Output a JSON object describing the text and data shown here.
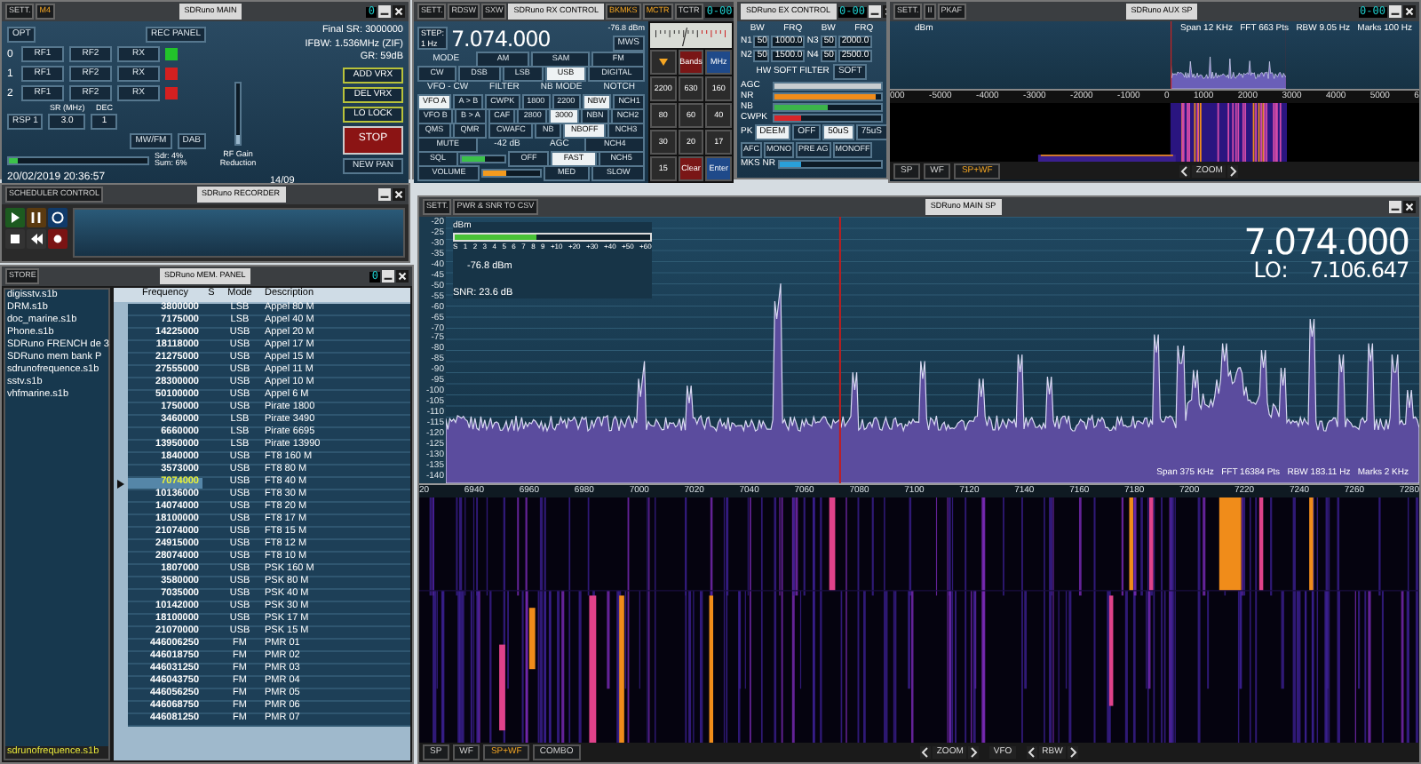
{
  "main_panel": {
    "title_buttons": [
      {
        "label": "SETT.",
        "selected": false
      },
      {
        "label": "M4",
        "selected": true
      }
    ],
    "title": "SDRuno MAIN",
    "display": "0",
    "opt": "OPT",
    "rec_panel": "REC PANEL",
    "info": [
      "Final SR: 3000000",
      "IFBW: 1.536MHz (ZIF)",
      "GR: 59dB"
    ],
    "rf_rows": [
      {
        "index": "0",
        "buttons": [
          "RF1",
          "RF2",
          "RX"
        ],
        "color": "#22c32a"
      },
      {
        "index": "1",
        "buttons": [
          "RF1",
          "RF2",
          "RX"
        ],
        "color": "#d42020"
      },
      {
        "index": "2",
        "buttons": [
          "RF1",
          "RF2",
          "RX"
        ],
        "color": "#d42020"
      }
    ],
    "side_buttons": [
      "ADD VRX",
      "DEL VRX",
      "LO LOCK"
    ],
    "device": "RSP 1",
    "sr_label": "SR (MHz)",
    "sr_value": "3.0",
    "dec_label": "DEC",
    "dec_value": "1",
    "mode_buttons": [
      "MW/FM",
      "DAB"
    ],
    "rf_gain": {
      "label": "RF Gain Reduction",
      "level": 0.15
    },
    "stop": "STOP",
    "new_pan": "NEW PAN",
    "cpu": {
      "level": 0.06
    },
    "stats": [
      "Sdr: 4%",
      "Sum: 6%"
    ],
    "datetime": "20/02/2019 20:36:57",
    "counter": "14/09"
  },
  "rx_control": {
    "title_buttons": [
      {
        "label": "SETT.",
        "selected": false
      },
      {
        "label": "RDSW",
        "selected": false
      },
      {
        "label": "SXW",
        "selected": false
      }
    ],
    "title": "SDRuno RX CONTROL",
    "title_buttons_right": [
      {
        "label": "BKMKS",
        "selected": true
      },
      {
        "label": "MCTR",
        "selected": true
      },
      {
        "label": "TCTR",
        "selected": false
      }
    ],
    "display": "0-00",
    "step_label": "STEP:",
    "step": "1 Hz",
    "frequency": "7.074.000",
    "level_reading": "-76.8 dBm",
    "mws": "MWS",
    "control_groups": [
      {
        "items": [
          {
            "kind": "label",
            "label": "MODE"
          },
          {
            "kind": "button",
            "label": "AM",
            "selected": false
          },
          {
            "kind": "button",
            "label": "SAM",
            "selected": false
          },
          {
            "kind": "button",
            "label": "FM",
            "selected": false
          }
        ]
      },
      {
        "items": [
          {
            "kind": "button",
            "label": "CW",
            "selected": false
          },
          {
            "kind": "button",
            "label": "DSB",
            "selected": false
          },
          {
            "kind": "button",
            "label": "LSB",
            "selected": false
          },
          {
            "kind": "button",
            "label": "USB",
            "selected": true
          },
          {
            "kind": "button",
            "label": "DIGITAL",
            "selected": false
          }
        ]
      },
      {
        "items": [
          {
            "kind": "label",
            "label": "VFO - CW"
          },
          {
            "kind": "label",
            "label": "FILTER"
          },
          {
            "kind": "label",
            "label": "NB MODE"
          },
          {
            "kind": "label",
            "label": "NOTCH"
          }
        ]
      },
      {
        "items": [
          {
            "kind": "button",
            "label": "VFO A",
            "selected": true
          },
          {
            "kind": "button",
            "label": "A > B",
            "selected": false
          },
          {
            "kind": "button",
            "label": "CWPK",
            "selected": false
          },
          {
            "kind": "button",
            "label": "1800",
            "selected": false
          },
          {
            "kind": "button",
            "label": "2200",
            "selected": false
          },
          {
            "kind": "button",
            "label": "NBW",
            "selected": true
          },
          {
            "kind": "button",
            "label": "NCH1",
            "selected": false
          }
        ]
      },
      {
        "items": [
          {
            "kind": "button",
            "label": "VFO B",
            "selected": false
          },
          {
            "kind": "button",
            "label": "B > A",
            "selected": false
          },
          {
            "kind": "button",
            "label": "CAF",
            "selected": false
          },
          {
            "kind": "button",
            "label": "2800",
            "selected": false
          },
          {
            "kind": "button",
            "label": "3000",
            "selected": true
          },
          {
            "kind": "button",
            "label": "NBN",
            "selected": false
          },
          {
            "kind": "button",
            "label": "NCH2",
            "selected": false
          }
        ]
      },
      {
        "items": [
          {
            "kind": "button",
            "label": "QMS",
            "selected": false
          },
          {
            "kind": "button",
            "label": "QMR",
            "selected": false
          },
          {
            "kind": "button",
            "label": "CWAFC",
            "selected": false
          },
          {
            "kind": "button",
            "label": "NB",
            "selected": false
          },
          {
            "kind": "button",
            "label": "NBOFF",
            "selected": true
          },
          {
            "kind": "button",
            "label": "NCH3",
            "selected": false
          }
        ]
      },
      {
        "items": [
          {
            "kind": "button",
            "label": "MUTE",
            "selected": false
          },
          {
            "kind": "label",
            "label": "-42 dB"
          },
          {
            "kind": "label",
            "label": "AGC"
          },
          {
            "kind": "button",
            "label": "NCH4",
            "selected": false
          }
        ]
      },
      {
        "items": [
          {
            "kind": "button",
            "label": "SQL",
            "selected": false
          },
          {
            "kind": "bar",
            "level": 0.55,
            "color": "#3cc24a"
          },
          {
            "kind": "button",
            "label": "OFF",
            "selected": false
          },
          {
            "kind": "button",
            "label": "FAST",
            "selected": true
          },
          {
            "kind": "button",
            "label": "NCH5",
            "selected": false
          }
        ]
      },
      {
        "items": [
          {
            "kind": "button",
            "label": "VOLUME",
            "selected": false
          },
          {
            "kind": "bar",
            "level": 0.4,
            "color": "#f39a1e"
          },
          {
            "kind": "button",
            "label": "MED",
            "selected": false
          },
          {
            "kind": "button",
            "label": "SLOW",
            "selected": false
          }
        ]
      }
    ],
    "keys": [
      {
        "kind": "arrow"
      },
      {
        "kind": "action",
        "label": "Bands"
      },
      {
        "kind": "unit",
        "label": "MHz"
      },
      {
        "kind": "number",
        "label": "2200"
      },
      {
        "kind": "number",
        "label": "630"
      },
      {
        "kind": "number",
        "label": "160"
      },
      {
        "kind": "number",
        "label": "80"
      },
      {
        "kind": "number",
        "label": "60"
      },
      {
        "kind": "number",
        "label": "40"
      },
      {
        "kind": "number",
        "label": "30"
      },
      {
        "kind": "number",
        "label": "20"
      },
      {
        "kind": "number",
        "label": "17"
      },
      {
        "kind": "number",
        "label": "15"
      },
      {
        "kind": "action",
        "label": "Clear"
      },
      {
        "kind": "unit",
        "label": "Enter"
      }
    ]
  },
  "ex_control": {
    "display": "0-00",
    "title": "SDRuno EX CONTROL",
    "headers": [
      "BW",
      "FRQ",
      "BW",
      "FRQ"
    ],
    "notches": [
      {
        "left": "N1",
        "bw1": "50",
        "frq1": "1000.0",
        "right": "N3",
        "bw2": "50",
        "frq2": "2000.0"
      },
      {
        "left": "N2",
        "bw1": "50",
        "frq1": "1500.0",
        "right": "N4",
        "bw2": "50",
        "frq2": "2500.0"
      }
    ],
    "filter_label": "HW SOFT FILTER",
    "filter_button": "SOFT",
    "bars": [
      {
        "label": "AGC",
        "level": 1.0,
        "color": "#c8cdd0"
      },
      {
        "label": "NR",
        "level": 0.95,
        "color": "#f08c1a"
      },
      {
        "label": "NB",
        "level": 0.5,
        "color": "#3cb44a"
      },
      {
        "label": "CWPK",
        "level": 0.25,
        "color": "#d8262a"
      }
    ],
    "pk_label": "PK",
    "pk_buttons": [
      {
        "label": "DEEM",
        "selected": true
      },
      {
        "label": "OFF",
        "selected": false
      },
      {
        "label": "50uS",
        "selected": true
      },
      {
        "label": "75uS",
        "selected": false
      }
    ],
    "extra_buttons": [
      "AFC",
      "MONO",
      "PRE AG",
      "MONOFF"
    ],
    "mks": {
      "label": "MKS NR",
      "level": 0.2,
      "color": "#2a9fd8"
    }
  },
  "aux_sp": {
    "title_buttons": [
      {
        "label": "SETT.",
        "selected": false
      },
      {
        "label": "II",
        "selected": false
      },
      {
        "label": "PKAF",
        "selected": false
      }
    ],
    "title": "SDRuno AUX SP",
    "display": "0-00",
    "unit": "dBm",
    "info": "Span 12 KHz   FFT 663 Pts   RBW 9.05 Hz   Marks 100 Hz",
    "x_ticks": [
      "000",
      "-5000",
      "-4000",
      "-3000",
      "-2000",
      "-1000",
      "0",
      "1000",
      "2000",
      "3000",
      "4000",
      "5000",
      "6"
    ],
    "view_buttons": [
      {
        "label": "SP",
        "selected": false
      },
      {
        "label": "WF",
        "selected": false
      },
      {
        "label": "SP+WF",
        "selected": true
      }
    ],
    "zoom": "ZOOM"
  },
  "recorder": {
    "title_buttons": [
      {
        "label": "SCHEDULER CONTROL",
        "selected": false
      }
    ],
    "title": "SDRuno RECORDER"
  },
  "memory_panel": {
    "title_buttons": [
      {
        "label": "STORE",
        "selected": false
      }
    ],
    "title": "SDRuno MEM. PANEL",
    "display": "0",
    "files": [
      "digisstv.s1b",
      "DRM.s1b",
      "doc_marine.s1b",
      "Phone.s1b",
      "SDRuno FRENCH de 3",
      "SDRuno mem bank P",
      "sdrunofrequence.s1b",
      "sstv.s1b",
      "vhfmarine.s1b"
    ],
    "current_file": "sdrunofrequence.s1b",
    "columns": [
      "Frequency",
      "S",
      "Mode",
      "Description"
    ],
    "rows": [
      {
        "frequency": "3800000",
        "mode": "LSB",
        "description": "Appel 80 M",
        "selected": false
      },
      {
        "frequency": "7175000",
        "mode": "LSB",
        "description": "Appel 40 M",
        "selected": false
      },
      {
        "frequency": "14225000",
        "mode": "USB",
        "description": "Appel 20 M",
        "selected": false
      },
      {
        "frequency": "18118000",
        "mode": "USB",
        "description": "Appel 17 M",
        "selected": false
      },
      {
        "frequency": "21275000",
        "mode": "USB",
        "description": "Appel 15 M",
        "selected": false
      },
      {
        "frequency": "27555000",
        "mode": "USB",
        "description": "Appel 11 M",
        "selected": false
      },
      {
        "frequency": "28300000",
        "mode": "USB",
        "description": "Appel 10 M",
        "selected": false
      },
      {
        "frequency": "50100000",
        "mode": "USB",
        "description": "Appel 6 M",
        "selected": false
      },
      {
        "frequency": "1750000",
        "mode": "USB",
        "description": "Pirate 1800",
        "selected": false
      },
      {
        "frequency": "3460000",
        "mode": "LSB",
        "description": "Pirate 3490",
        "selected": false
      },
      {
        "frequency": "6660000",
        "mode": "LSB",
        "description": "Pirate 6695",
        "selected": false
      },
      {
        "frequency": "13950000",
        "mode": "LSB",
        "description": "Pirate 13990",
        "selected": false
      },
      {
        "frequency": "1840000",
        "mode": "USB",
        "description": "FT8 160 M",
        "selected": false
      },
      {
        "frequency": "3573000",
        "mode": "USB",
        "description": "FT8 80 M",
        "selected": false
      },
      {
        "frequency": "7074000",
        "mode": "USB",
        "description": "FT8 40 M",
        "selected": true
      },
      {
        "frequency": "10136000",
        "mode": "USB",
        "description": "FT8 30 M",
        "selected": false
      },
      {
        "frequency": "14074000",
        "mode": "USB",
        "description": "FT8 20 M",
        "selected": false
      },
      {
        "frequency": "18100000",
        "mode": "USB",
        "description": "FT8 17 M",
        "selected": false
      },
      {
        "frequency": "21074000",
        "mode": "USB",
        "description": "FT8 15 M",
        "selected": false
      },
      {
        "frequency": "24915000",
        "mode": "USB",
        "description": "FT8 12 M",
        "selected": false
      },
      {
        "frequency": "28074000",
        "mode": "USB",
        "description": "FT8 10 M",
        "selected": false
      },
      {
        "frequency": "1807000",
        "mode": "USB",
        "description": "PSK 160 M",
        "selected": false
      },
      {
        "frequency": "3580000",
        "mode": "USB",
        "description": "PSK 80 M",
        "selected": false
      },
      {
        "frequency": "7035000",
        "mode": "USB",
        "description": "PSK 40 M",
        "selected": false
      },
      {
        "frequency": "10142000",
        "mode": "USB",
        "description": "PSK 30 M",
        "selected": false
      },
      {
        "frequency": "18100000",
        "mode": "USB",
        "description": "PSK 17 M",
        "selected": false
      },
      {
        "frequency": "21070000",
        "mode": "USB",
        "description": "PSK 15 M",
        "selected": false
      },
      {
        "frequency": "446006250",
        "mode": "FM",
        "description": "PMR 01",
        "selected": false
      },
      {
        "frequency": "446018750",
        "mode": "FM",
        "description": "PMR 02",
        "selected": false
      },
      {
        "frequency": "446031250",
        "mode": "FM",
        "description": "PMR 03",
        "selected": false
      },
      {
        "frequency": "446043750",
        "mode": "FM",
        "description": "PMR 04",
        "selected": false
      },
      {
        "frequency": "446056250",
        "mode": "FM",
        "description": "PMR 05",
        "selected": false
      },
      {
        "frequency": "446068750",
        "mode": "FM",
        "description": "PMR 06",
        "selected": false
      },
      {
        "frequency": "446081250",
        "mode": "FM",
        "description": "PMR 07",
        "selected": false
      }
    ]
  },
  "main_sp": {
    "title_buttons": [
      {
        "label": "SETT.",
        "selected": false
      },
      {
        "label": "PWR & SNR TO CSV",
        "selected": false
      }
    ],
    "title": "SDRuno MAIN SP",
    "y_ticks": [
      "-20",
      "-25",
      "-30",
      "-35",
      "-40",
      "-45",
      "-50",
      "-55",
      "-60",
      "-65",
      "-70",
      "-75",
      "-80",
      "-85",
      "-90",
      "-95",
      "-100",
      "-105",
      "-110",
      "-115",
      "-120",
      "-125",
      "-130",
      "-135",
      "-140"
    ],
    "smeter": {
      "unit": "dBm",
      "scale": [
        "S",
        "1",
        "2",
        "3",
        "4",
        "5",
        "6",
        "7",
        "8",
        "9",
        "+10",
        "+20",
        "+30",
        "+40",
        "+50",
        "+60"
      ],
      "level": 0.42
    },
    "power": "-76.8 dBm",
    "snr": "SNR: 23.6 dB",
    "frequency": "7.074.000",
    "lo_label": "LO:",
    "lo": "7.106.647",
    "info": "Span 375 KHz   FFT 16384 Pts   RBW 183.11 Hz   Marks 2 KHz",
    "x_ticks": [
      "20",
      "6940",
      "6960",
      "6980",
      "7000",
      "7020",
      "7040",
      "7060",
      "7080",
      "7100",
      "7120",
      "7140",
      "7160",
      "7180",
      "7200",
      "7220",
      "7240",
      "7260",
      "7280"
    ],
    "view_buttons": [
      {
        "label": "SP",
        "selected": false
      },
      {
        "label": "WF",
        "selected": false
      },
      {
        "label": "SP+WF",
        "selected": true
      },
      {
        "label": "COMBO",
        "selected": false
      }
    ],
    "zoom": "ZOOM",
    "vfo": "VFO",
    "rbw": "RBW"
  }
}
